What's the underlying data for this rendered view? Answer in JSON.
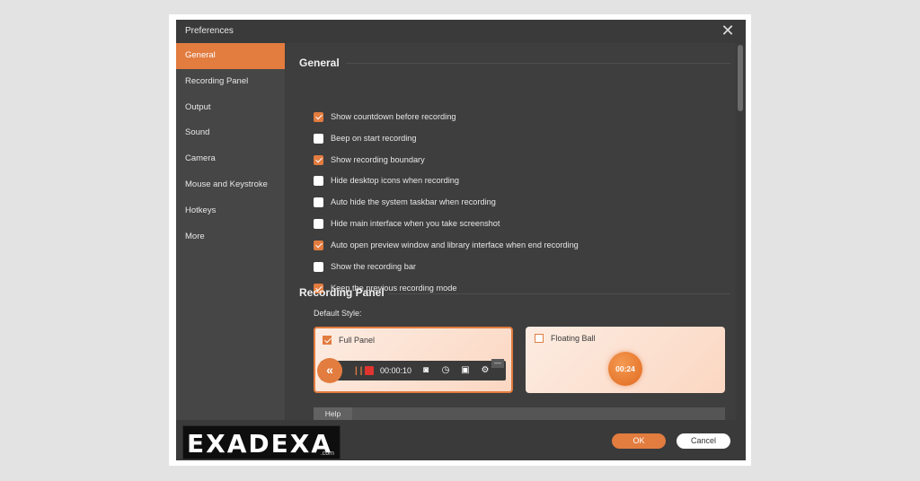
{
  "window": {
    "title": "Preferences",
    "close_icon": "close-icon"
  },
  "sidebar": {
    "items": [
      {
        "label": "General",
        "active": true
      },
      {
        "label": "Recording Panel"
      },
      {
        "label": "Output"
      },
      {
        "label": "Sound"
      },
      {
        "label": "Camera"
      },
      {
        "label": "Mouse and Keystroke"
      },
      {
        "label": "Hotkeys"
      },
      {
        "label": "More"
      }
    ]
  },
  "general": {
    "title": "General",
    "options": [
      {
        "label": "Show countdown before recording",
        "checked": true
      },
      {
        "label": "Beep on start recording",
        "checked": false
      },
      {
        "label": "Show recording boundary",
        "checked": true
      },
      {
        "label": "Hide desktop icons when recording",
        "checked": false
      },
      {
        "label": "Auto hide the system taskbar when recording",
        "checked": false
      },
      {
        "label": "Hide main interface when you take screenshot",
        "checked": false
      },
      {
        "label": "Auto open preview window and library interface when end recording",
        "checked": true
      },
      {
        "label": "Show the recording bar",
        "checked": false
      },
      {
        "label": "Keep the previous recording mode",
        "checked": true
      }
    ]
  },
  "recording_panel": {
    "title": "Recording Panel",
    "default_style_label": "Default Style:",
    "full_panel": {
      "label": "Full Panel",
      "checked": true,
      "time": "00:00:10"
    },
    "floating_ball": {
      "label": "Floating Ball",
      "checked": false,
      "time": "00:24"
    }
  },
  "help": {
    "label": "Help"
  },
  "footer": {
    "ok_label": "OK",
    "cancel_label": "Cancel"
  },
  "watermark": {
    "text": "EXADEXA",
    "suffix": ".com"
  },
  "colors": {
    "accent": "#e27c3f",
    "window_bg": "#3c3c3c",
    "sidebar_bg": "#464646"
  }
}
